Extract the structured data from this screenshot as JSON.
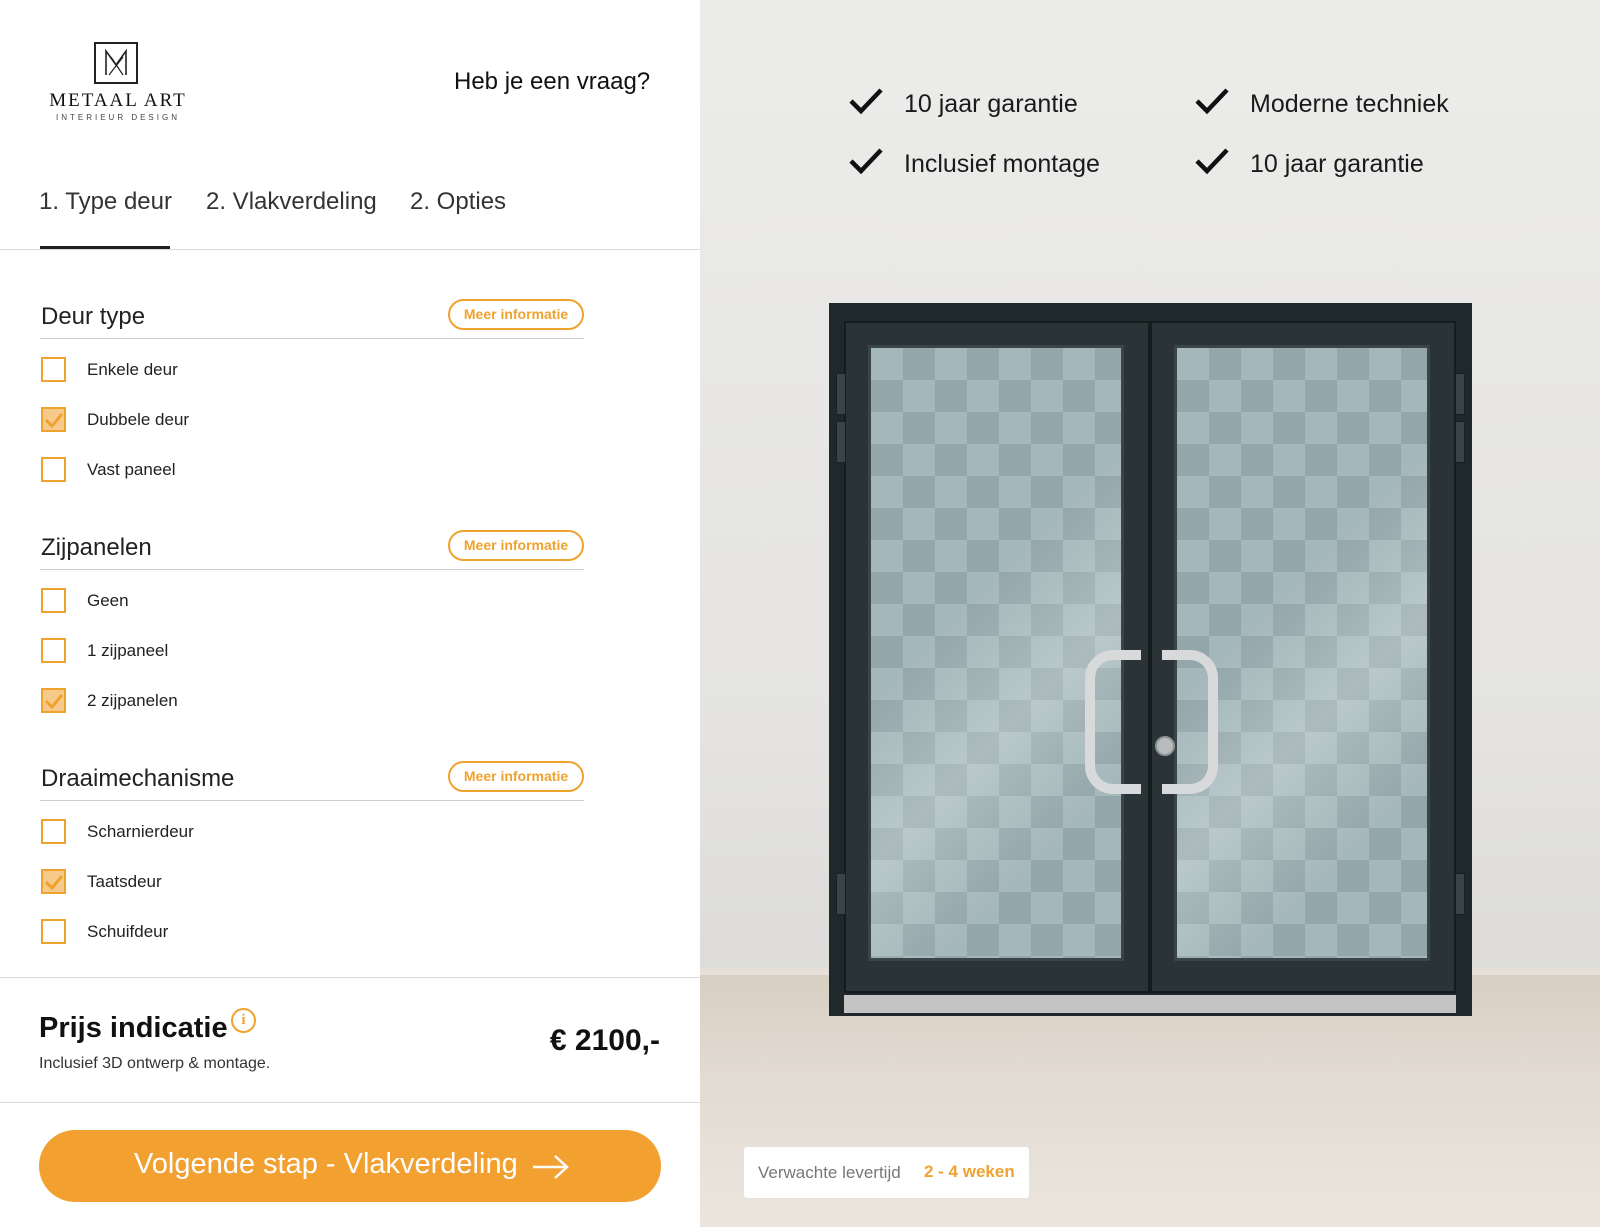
{
  "brand": {
    "name": "METAAL ART",
    "tagline": "INTERIEUR DESIGN"
  },
  "header": {
    "help_link": "Heb je een vraag?"
  },
  "tabs": [
    {
      "label": "1. Type deur",
      "active": true
    },
    {
      "label": "2. Vlakverdeling",
      "active": false
    },
    {
      "label": "2. Opties",
      "active": false
    }
  ],
  "groups": [
    {
      "title": "Deur type",
      "info_button": "Meer informatie",
      "options": [
        {
          "label": "Enkele deur",
          "checked": false
        },
        {
          "label": "Dubbele deur",
          "checked": true
        },
        {
          "label": "Vast paneel",
          "checked": false
        }
      ]
    },
    {
      "title": "Zijpanelen",
      "info_button": "Meer informatie",
      "options": [
        {
          "label": "Geen",
          "checked": false
        },
        {
          "label": "1 zijpaneel",
          "checked": false
        },
        {
          "label": "2 zijpanelen",
          "checked": true
        }
      ]
    },
    {
      "title": "Draaimechanisme",
      "info_button": "Meer informatie",
      "options": [
        {
          "label": "Scharnierdeur",
          "checked": false
        },
        {
          "label": "Taatsdeur",
          "checked": true
        },
        {
          "label": "Schuifdeur",
          "checked": false
        }
      ]
    }
  ],
  "price": {
    "title": "Prijs indicatie",
    "info_icon": "i",
    "subtitle": "Inclusief 3D ontwerp & montage.",
    "value": "€ 2100,-"
  },
  "next_button": {
    "label": "Volgende stap - Vlakverdeling",
    "icon": "arrow-right-icon"
  },
  "features": [
    {
      "label": "10 jaar garantie",
      "icon": "check-icon"
    },
    {
      "label": "Moderne techniek",
      "icon": "check-icon"
    },
    {
      "label": "Inclusief montage",
      "icon": "check-icon"
    },
    {
      "label": "10 jaar garantie",
      "icon": "check-icon"
    }
  ],
  "delivery": {
    "label": "Verwachte levertijd",
    "value": "2 - 4 weken"
  },
  "colors": {
    "accent": "#f0a22e",
    "button": "#f2a030",
    "door_frame": "#1f282b",
    "checked_fill": "#f7c98a"
  }
}
